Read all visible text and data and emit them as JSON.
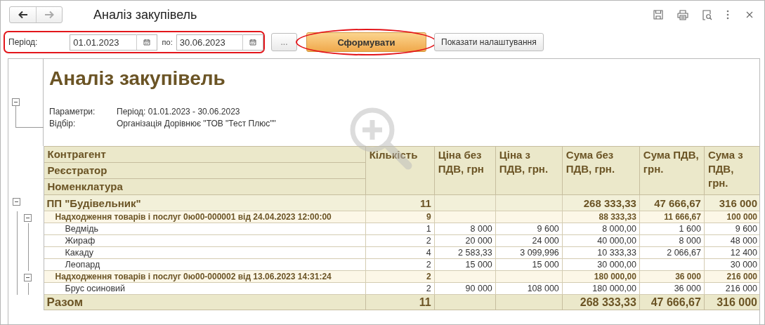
{
  "window": {
    "title": "Аналіз закупівель"
  },
  "nav": {
    "back_disabled": false,
    "forward_disabled": true
  },
  "period": {
    "label": "Період:",
    "from": "01.01.2023",
    "to_label": "по:",
    "to": "30.06.2023",
    "highlighted": true
  },
  "buttons": [
    {
      "label": "...",
      "kind": "plain",
      "highlighted": false
    },
    {
      "label": "Сформувати",
      "kind": "default",
      "highlighted": true
    },
    {
      "label": "Показати налаштування",
      "kind": "plain",
      "highlighted": false
    }
  ],
  "report": {
    "title": "Аналіз закупівель",
    "expanded": true,
    "params": [
      {
        "label": "Параметри:",
        "value": "Період: 01.01.2023 - 30.06.2023"
      },
      {
        "label": "Відбір:",
        "value": "Організація Дорівнює \"ТОВ \"Тест Плюс\"\""
      }
    ],
    "table": {
      "group_headers": [
        "Контрагент",
        "Реєстратор",
        "Номенклатура"
      ],
      "columns": [
        "Кількість",
        "Ціна без ПДВ, грн",
        "Ціна з ПДВ, грн.",
        "Сума без ПДВ, грн.",
        "Сума ПДВ, грн.",
        "Сума з ПДВ, грн."
      ],
      "rows": [
        {
          "kind": "counterparty",
          "name": "ПП \"Будівельник\"",
          "quantity": "11",
          "sum_net": "268 333,33",
          "vat": "47 666,67",
          "sum_gross": "316 000",
          "expanded": true,
          "children": [
            {
              "kind": "document",
              "name": "Надходження товарів і послуг 0ю00-000001 від 24.04.2023 12:00:00",
              "quantity": "9",
              "sum_net": "88 333,33",
              "vat": "11 666,67",
              "sum_gross": "100 000",
              "expanded": true,
              "children": [
                {
                  "kind": "item",
                  "name": "Ведмідь",
                  "quantity": "1",
                  "price_net": "8 000",
                  "price_gross": "9 600",
                  "sum_net": "8 000,00",
                  "vat": "1 600",
                  "sum_gross": "9 600"
                },
                {
                  "kind": "item",
                  "name": "Жираф",
                  "quantity": "2",
                  "price_net": "20 000",
                  "price_gross": "24 000",
                  "sum_net": "40 000,00",
                  "vat": "8 000",
                  "sum_gross": "48 000"
                },
                {
                  "kind": "item",
                  "name": "Какаду",
                  "quantity": "4",
                  "price_net": "2 583,33",
                  "price_gross": "3 099,996",
                  "sum_net": "10 333,33",
                  "vat": "2 066,67",
                  "sum_gross": "12 400"
                },
                {
                  "kind": "item",
                  "name": "Леопард",
                  "quantity": "2",
                  "price_net": "15 000",
                  "price_gross": "15 000",
                  "sum_net": "30 000,00",
                  "sum_gross": "30 000"
                }
              ]
            },
            {
              "kind": "document",
              "name": "Надходження товарів і послуг 0ю00-000002 від 13.06.2023 14:31:24",
              "quantity": "2",
              "sum_net": "180 000,00",
              "vat": "36 000",
              "sum_gross": "216 000",
              "expanded": true,
              "children": [
                {
                  "kind": "item",
                  "name": "Брус осиновий",
                  "quantity": "2",
                  "price_net": "90 000",
                  "price_gross": "108 000",
                  "sum_net": "180 000,00",
                  "vat": "36 000",
                  "sum_gross": "216 000"
                }
              ]
            }
          ]
        }
      ],
      "total": {
        "name": "Разом",
        "quantity": "11",
        "sum_net": "268 333,33",
        "vat": "47 666,67",
        "sum_gross": "316 000"
      }
    }
  }
}
